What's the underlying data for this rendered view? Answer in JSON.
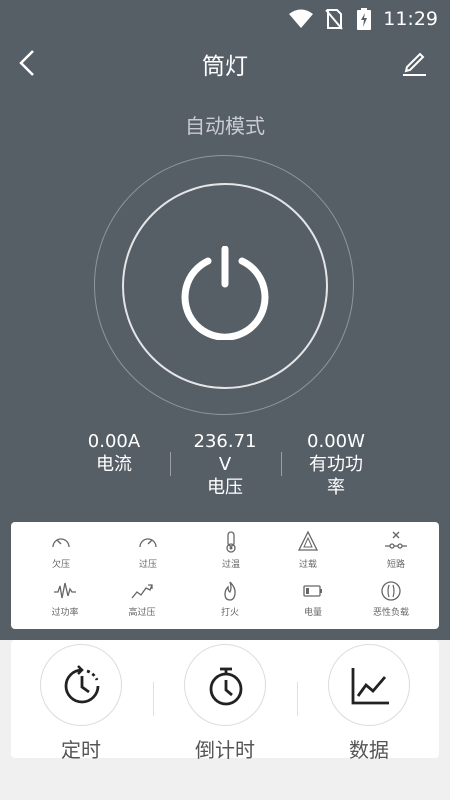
{
  "status_bar": {
    "time": "11:29"
  },
  "app_bar": {
    "title": "筒灯"
  },
  "mode": "自动模式",
  "readings": [
    {
      "value": "0.00A",
      "label": "电流"
    },
    {
      "value": "236.71",
      "unit": "V",
      "label": "电压"
    },
    {
      "value": "0.00W",
      "label": "有功功",
      "label2": "率"
    }
  ],
  "protections": [
    {
      "label": "欠压",
      "icon": "gauge-low-icon"
    },
    {
      "label": "过压",
      "icon": "gauge-high-icon"
    },
    {
      "label": "过温",
      "icon": "thermometer-icon"
    },
    {
      "label": "过载",
      "icon": "overload-triangle-icon"
    },
    {
      "label": "短路",
      "icon": "short-circuit-icon"
    },
    {
      "label": "过功率",
      "icon": "power-wave-icon"
    },
    {
      "label": "高过压",
      "icon": "trend-up-icon"
    },
    {
      "label": "打火",
      "icon": "flame-icon"
    },
    {
      "label": "电量",
      "icon": "battery-icon"
    },
    {
      "label": "恶性负载",
      "icon": "malicious-load-icon"
    }
  ],
  "functions": [
    {
      "label": "定时",
      "icon": "timer-icon"
    },
    {
      "label": "倒计时",
      "icon": "stopwatch-icon"
    },
    {
      "label": "数据",
      "icon": "line-chart-icon"
    }
  ]
}
